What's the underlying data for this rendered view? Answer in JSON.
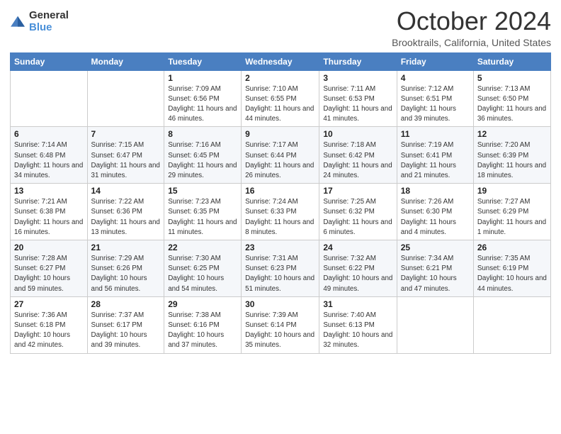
{
  "logo": {
    "general": "General",
    "blue": "Blue"
  },
  "header": {
    "month": "October 2024",
    "location": "Brooktrails, California, United States"
  },
  "weekdays": [
    "Sunday",
    "Monday",
    "Tuesday",
    "Wednesday",
    "Thursday",
    "Friday",
    "Saturday"
  ],
  "weeks": [
    [
      {
        "day": "",
        "info": ""
      },
      {
        "day": "",
        "info": ""
      },
      {
        "day": "1",
        "info": "Sunrise: 7:09 AM\nSunset: 6:56 PM\nDaylight: 11 hours and 46 minutes."
      },
      {
        "day": "2",
        "info": "Sunrise: 7:10 AM\nSunset: 6:55 PM\nDaylight: 11 hours and 44 minutes."
      },
      {
        "day": "3",
        "info": "Sunrise: 7:11 AM\nSunset: 6:53 PM\nDaylight: 11 hours and 41 minutes."
      },
      {
        "day": "4",
        "info": "Sunrise: 7:12 AM\nSunset: 6:51 PM\nDaylight: 11 hours and 39 minutes."
      },
      {
        "day": "5",
        "info": "Sunrise: 7:13 AM\nSunset: 6:50 PM\nDaylight: 11 hours and 36 minutes."
      }
    ],
    [
      {
        "day": "6",
        "info": "Sunrise: 7:14 AM\nSunset: 6:48 PM\nDaylight: 11 hours and 34 minutes."
      },
      {
        "day": "7",
        "info": "Sunrise: 7:15 AM\nSunset: 6:47 PM\nDaylight: 11 hours and 31 minutes."
      },
      {
        "day": "8",
        "info": "Sunrise: 7:16 AM\nSunset: 6:45 PM\nDaylight: 11 hours and 29 minutes."
      },
      {
        "day": "9",
        "info": "Sunrise: 7:17 AM\nSunset: 6:44 PM\nDaylight: 11 hours and 26 minutes."
      },
      {
        "day": "10",
        "info": "Sunrise: 7:18 AM\nSunset: 6:42 PM\nDaylight: 11 hours and 24 minutes."
      },
      {
        "day": "11",
        "info": "Sunrise: 7:19 AM\nSunset: 6:41 PM\nDaylight: 11 hours and 21 minutes."
      },
      {
        "day": "12",
        "info": "Sunrise: 7:20 AM\nSunset: 6:39 PM\nDaylight: 11 hours and 18 minutes."
      }
    ],
    [
      {
        "day": "13",
        "info": "Sunrise: 7:21 AM\nSunset: 6:38 PM\nDaylight: 11 hours and 16 minutes."
      },
      {
        "day": "14",
        "info": "Sunrise: 7:22 AM\nSunset: 6:36 PM\nDaylight: 11 hours and 13 minutes."
      },
      {
        "day": "15",
        "info": "Sunrise: 7:23 AM\nSunset: 6:35 PM\nDaylight: 11 hours and 11 minutes."
      },
      {
        "day": "16",
        "info": "Sunrise: 7:24 AM\nSunset: 6:33 PM\nDaylight: 11 hours and 8 minutes."
      },
      {
        "day": "17",
        "info": "Sunrise: 7:25 AM\nSunset: 6:32 PM\nDaylight: 11 hours and 6 minutes."
      },
      {
        "day": "18",
        "info": "Sunrise: 7:26 AM\nSunset: 6:30 PM\nDaylight: 11 hours and 4 minutes."
      },
      {
        "day": "19",
        "info": "Sunrise: 7:27 AM\nSunset: 6:29 PM\nDaylight: 11 hours and 1 minute."
      }
    ],
    [
      {
        "day": "20",
        "info": "Sunrise: 7:28 AM\nSunset: 6:27 PM\nDaylight: 10 hours and 59 minutes."
      },
      {
        "day": "21",
        "info": "Sunrise: 7:29 AM\nSunset: 6:26 PM\nDaylight: 10 hours and 56 minutes."
      },
      {
        "day": "22",
        "info": "Sunrise: 7:30 AM\nSunset: 6:25 PM\nDaylight: 10 hours and 54 minutes."
      },
      {
        "day": "23",
        "info": "Sunrise: 7:31 AM\nSunset: 6:23 PM\nDaylight: 10 hours and 51 minutes."
      },
      {
        "day": "24",
        "info": "Sunrise: 7:32 AM\nSunset: 6:22 PM\nDaylight: 10 hours and 49 minutes."
      },
      {
        "day": "25",
        "info": "Sunrise: 7:34 AM\nSunset: 6:21 PM\nDaylight: 10 hours and 47 minutes."
      },
      {
        "day": "26",
        "info": "Sunrise: 7:35 AM\nSunset: 6:19 PM\nDaylight: 10 hours and 44 minutes."
      }
    ],
    [
      {
        "day": "27",
        "info": "Sunrise: 7:36 AM\nSunset: 6:18 PM\nDaylight: 10 hours and 42 minutes."
      },
      {
        "day": "28",
        "info": "Sunrise: 7:37 AM\nSunset: 6:17 PM\nDaylight: 10 hours and 39 minutes."
      },
      {
        "day": "29",
        "info": "Sunrise: 7:38 AM\nSunset: 6:16 PM\nDaylight: 10 hours and 37 minutes."
      },
      {
        "day": "30",
        "info": "Sunrise: 7:39 AM\nSunset: 6:14 PM\nDaylight: 10 hours and 35 minutes."
      },
      {
        "day": "31",
        "info": "Sunrise: 7:40 AM\nSunset: 6:13 PM\nDaylight: 10 hours and 32 minutes."
      },
      {
        "day": "",
        "info": ""
      },
      {
        "day": "",
        "info": ""
      }
    ]
  ]
}
